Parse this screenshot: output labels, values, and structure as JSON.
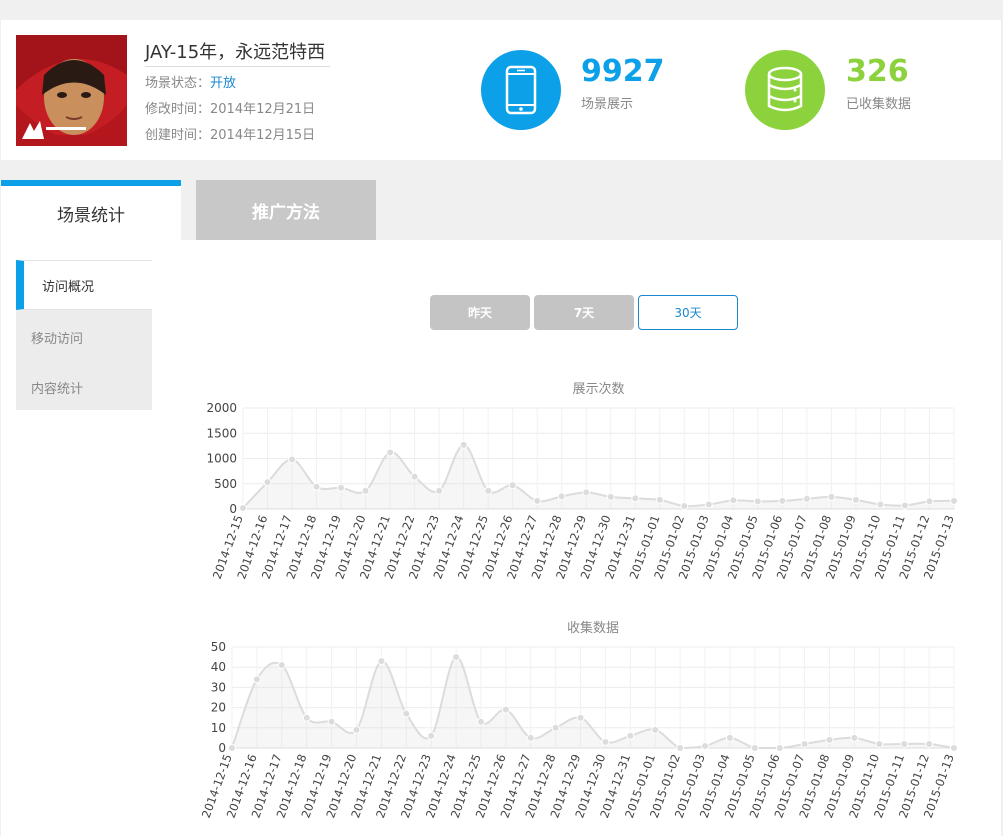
{
  "scene": {
    "title": "JAY-15年，永远范特西",
    "status_label": "场景状态：",
    "status_value": "开放",
    "modified": "修改时间：2014年12月21日",
    "created": "创建时间：2014年12月15日"
  },
  "stats": {
    "views_value": "9927",
    "views_label": "场景展示",
    "data_value": "326",
    "data_label": "已收集数据",
    "views_color": "#0ba0e8",
    "data_color": "#8cd23c",
    "views_icon": "smartphone-icon",
    "data_icon": "database-icon"
  },
  "tabs": {
    "stats": "场景统计",
    "promo": "推广方法"
  },
  "side_menu": [
    "访问概况",
    "移动访问",
    "内容统计"
  ],
  "range_buttons": [
    "昨天",
    "7天",
    "30天"
  ],
  "chart_data": [
    {
      "type": "area",
      "title": "展示次数",
      "categories": [
        "2014-12-15",
        "2014-12-16",
        "2014-12-17",
        "2014-12-18",
        "2014-12-19",
        "2014-12-20",
        "2014-12-21",
        "2014-12-22",
        "2014-12-23",
        "2014-12-24",
        "2014-12-25",
        "2014-12-26",
        "2014-12-27",
        "2014-12-28",
        "2014-12-29",
        "2014-12-30",
        "2014-12-31",
        "2015-01-01",
        "2015-01-02",
        "2015-01-03",
        "2015-01-04",
        "2015-01-05",
        "2015-01-06",
        "2015-01-07",
        "2015-01-08",
        "2015-01-09",
        "2015-01-10",
        "2015-01-11",
        "2015-01-12",
        "2015-01-13"
      ],
      "values": [
        20,
        530,
        980,
        440,
        420,
        360,
        1120,
        640,
        360,
        1270,
        360,
        470,
        160,
        250,
        330,
        240,
        210,
        180,
        60,
        90,
        170,
        150,
        160,
        200,
        240,
        180,
        90,
        70,
        150,
        160
      ],
      "yticks": [
        "0",
        "500",
        "1000",
        "1500",
        "2000"
      ],
      "ylim": [
        0,
        2000
      ],
      "grid": true
    },
    {
      "type": "area",
      "title": "收集数据",
      "categories": [
        "2014-12-15",
        "2014-12-16",
        "2014-12-17",
        "2014-12-18",
        "2014-12-19",
        "2014-12-20",
        "2014-12-21",
        "2014-12-22",
        "2014-12-23",
        "2014-12-24",
        "2014-12-25",
        "2014-12-26",
        "2014-12-27",
        "2014-12-28",
        "2014-12-29",
        "2014-12-30",
        "2014-12-31",
        "2015-01-01",
        "2015-01-02",
        "2015-01-03",
        "2015-01-04",
        "2015-01-05",
        "2015-01-06",
        "2015-01-07",
        "2015-01-08",
        "2015-01-09",
        "2015-01-10",
        "2015-01-11",
        "2015-01-12",
        "2015-01-13"
      ],
      "values": [
        0,
        34,
        41,
        15,
        13,
        9,
        43,
        17,
        6,
        45,
        13,
        19,
        5,
        10,
        15,
        3,
        6,
        9,
        0,
        1,
        5,
        0,
        0,
        2,
        4,
        5,
        2,
        2,
        2,
        0
      ],
      "yticks": [
        "0",
        "10",
        "20",
        "30",
        "40",
        "50"
      ],
      "ylim": [
        0,
        50
      ],
      "grid": true
    }
  ]
}
